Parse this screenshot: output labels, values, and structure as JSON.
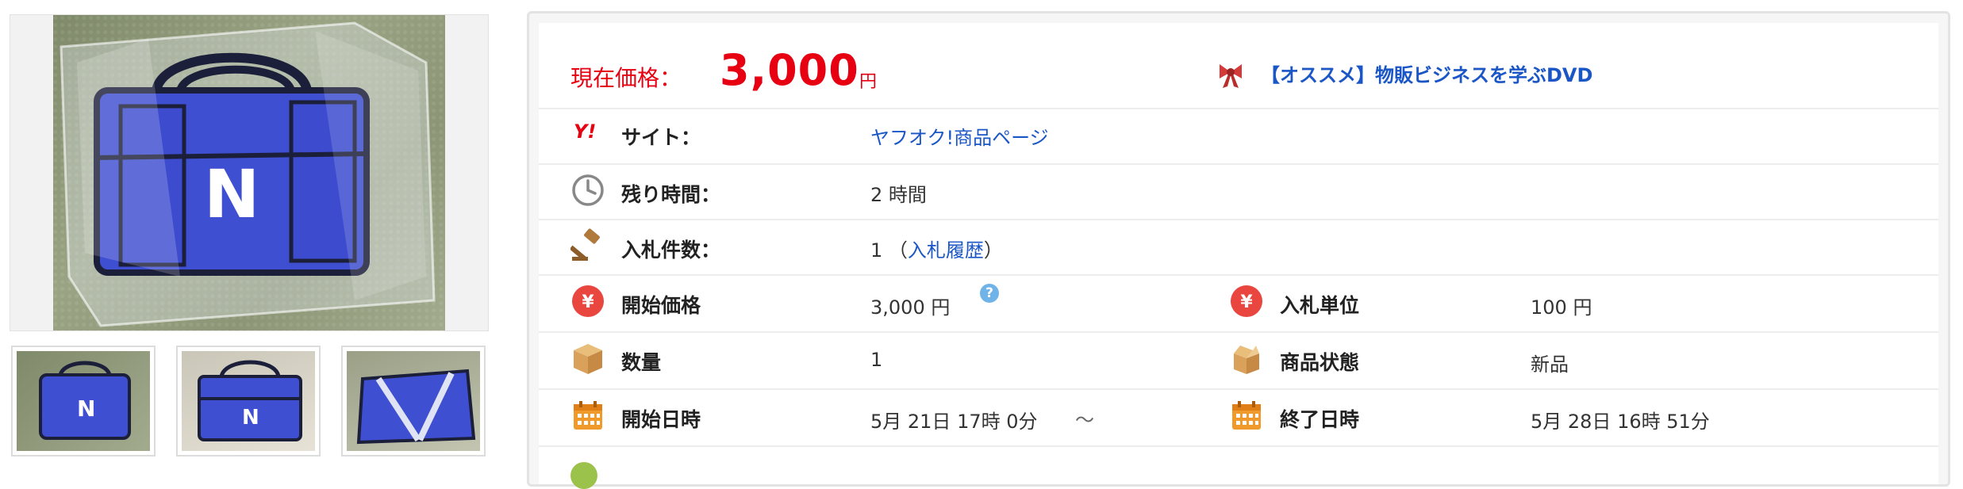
{
  "price": {
    "label": "現在価格：",
    "value": "3,000",
    "unit": "円"
  },
  "promo": {
    "icon": "gift-ribbon-icon",
    "text": "【オススメ】物販ビジネスを学ぶDVD"
  },
  "site": {
    "label": "サイト：",
    "value": "ヤフオク!商品ページ",
    "icon": "yahoo-auction-icon",
    "icon_text": "Y!"
  },
  "remaining": {
    "label": "残り時間：",
    "value": "2 時間",
    "icon": "clock-icon"
  },
  "bids": {
    "label": "入札件数：",
    "count": "1",
    "open": "（",
    "link": "入札履歴",
    "close": "）",
    "icon": "gavel-icon"
  },
  "start_price": {
    "label": "開始価格",
    "value": "3,000 円",
    "icon": "yen-icon",
    "help": "?"
  },
  "bid_unit": {
    "label": "入札単位",
    "value": "100 円",
    "icon": "yen-icon"
  },
  "quantity": {
    "label": "数量",
    "value": "1",
    "icon": "box-icon"
  },
  "condition": {
    "label": "商品状態",
    "value": "新品",
    "icon": "open-box-icon"
  },
  "start_date": {
    "label": "開始日時",
    "value": "5月 21日 17時 0分",
    "separator": "～",
    "icon": "calendar-icon"
  },
  "end_date": {
    "label": "終了日時",
    "value": "5月 28日 16時 51分",
    "icon": "calendar-icon"
  },
  "colors": {
    "price": "#e60012",
    "link": "#1a56c6",
    "yen_icon": "#e8463f",
    "calendar_icon": "#f19a2c",
    "box_icon": "#d9a15a"
  }
}
